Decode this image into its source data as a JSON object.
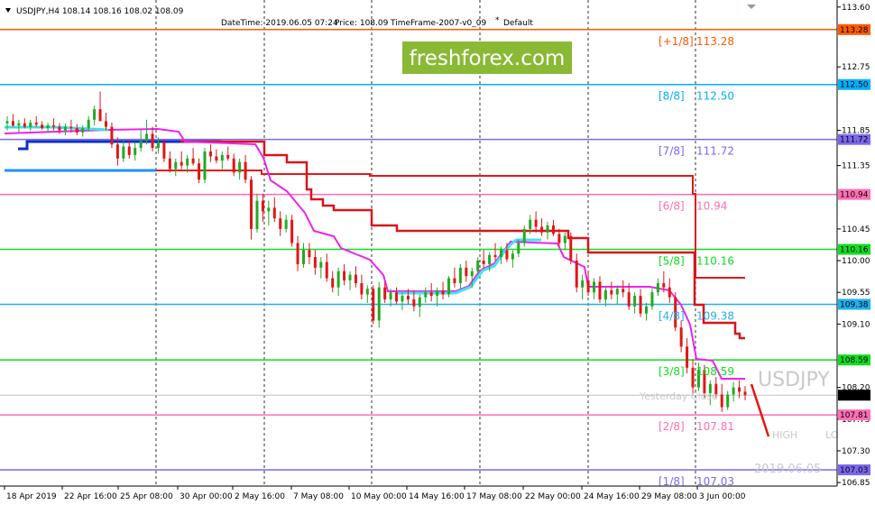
{
  "header": {
    "symbol_line": "USDJPY,H4  108.14 108.16 108.02 108.09",
    "date_label": "DateTime: 2019.06.05 07:24",
    "price_label": "Price: 108.09",
    "timeframe_label": "TimeFrame-2007-v0_09",
    "default_label": "Default"
  },
  "watermark": {
    "brand": "freshforex.com",
    "brand_color": "#8ab935",
    "symbol": "USDJPY",
    "yesterday": "Yesterday Close",
    "high_label": "HIGH",
    "low_label": "LO",
    "date_faint": "2019.06.05"
  },
  "chart_data": {
    "type": "candlestick",
    "symbol": "USDJPY",
    "timeframe": "H4",
    "ylim": [
      106.8,
      113.7
    ],
    "y_ticks": [
      "113.60",
      "112.75",
      "111.85",
      "111.35",
      "110.45",
      "110.00",
      "109.55",
      "109.10",
      "108.20",
      "107.75",
      "107.30",
      "106.85"
    ],
    "x_ticks": [
      "18 Apr 2019",
      "22 Apr 16:00",
      "25 Apr 08:00",
      "30 Apr 00:00",
      "2 May 16:00",
      "7 May 08:00",
      "10 May 00:00",
      "14 May 16:00",
      "17 May 08:00",
      "22 May 00:00",
      "24 May 16:00",
      "29 May 08:00",
      "3 Jun 00:00"
    ],
    "current_price": "108.09",
    "current_price_alt": "108.14",
    "murrey_levels": [
      {
        "label": "[+1/8]",
        "value": 113.28,
        "value_text": "113.28",
        "color": "#ff5a00"
      },
      {
        "label": "[8/8]",
        "value": 112.5,
        "value_text": "112.50",
        "color": "#00b0ff"
      },
      {
        "label": "[7/8]",
        "value": 111.72,
        "value_text": "111.72",
        "color": "#7b68ee"
      },
      {
        "label": "[6/8]",
        "value": 110.94,
        "value_text": "10.94",
        "color": "#ff6eb4"
      },
      {
        "label": "[5/8]",
        "value": 110.16,
        "value_text": "110.16",
        "color": "#11dd22"
      },
      {
        "label": "[4/8]",
        "value": 109.38,
        "value_text": "109.38",
        "color": "#1eb0f0"
      },
      {
        "label": "[3/8]",
        "value": 108.59,
        "value_text": "108.59",
        "color": "#11dd22"
      },
      {
        "label": "[2/8]",
        "value": 107.81,
        "value_text": "107.81",
        "color": "#ff6eb4"
      },
      {
        "label": "[1/8]",
        "value": 107.03,
        "value_text": "107.03",
        "color": "#7b68ee"
      }
    ],
    "axis_badges": [
      "113.28",
      "112.50",
      "111.72",
      "110.94",
      "110.16",
      "109.38",
      "108.59",
      "107.81",
      "107.03"
    ],
    "candles": [
      [
        111.95,
        112.05,
        111.85,
        111.98
      ],
      [
        111.98,
        112.08,
        111.9,
        111.92
      ],
      [
        111.92,
        112.0,
        111.82,
        111.95
      ],
      [
        111.95,
        112.02,
        111.88,
        111.9
      ],
      [
        111.9,
        112.0,
        111.84,
        111.96
      ],
      [
        111.96,
        112.05,
        111.9,
        111.93
      ],
      [
        111.93,
        111.98,
        111.86,
        111.88
      ],
      [
        111.88,
        111.96,
        111.82,
        111.92
      ],
      [
        111.92,
        112.02,
        111.85,
        111.9
      ],
      [
        111.9,
        111.95,
        111.8,
        111.85
      ],
      [
        111.85,
        111.95,
        111.78,
        111.9
      ],
      [
        111.9,
        112.0,
        111.82,
        111.88
      ],
      [
        111.88,
        111.94,
        111.78,
        111.82
      ],
      [
        111.82,
        111.92,
        111.76,
        111.88
      ],
      [
        111.88,
        112.05,
        111.84,
        112.0
      ],
      [
        112.0,
        112.2,
        111.92,
        112.15
      ],
      [
        112.15,
        112.4,
        112.05,
        111.98
      ],
      [
        111.98,
        112.1,
        111.85,
        111.9
      ],
      [
        111.9,
        111.96,
        111.6,
        111.65
      ],
      [
        111.65,
        111.75,
        111.35,
        111.45
      ],
      [
        111.45,
        111.7,
        111.4,
        111.62
      ],
      [
        111.62,
        111.72,
        111.45,
        111.5
      ],
      [
        111.5,
        111.68,
        111.42,
        111.6
      ],
      [
        111.6,
        111.85,
        111.55,
        111.7
      ],
      [
        111.7,
        112.0,
        111.65,
        111.8
      ],
      [
        111.8,
        111.9,
        111.55,
        111.6
      ],
      [
        111.6,
        111.75,
        111.52,
        111.68
      ],
      [
        111.68,
        111.72,
        111.4,
        111.45
      ],
      [
        111.45,
        111.55,
        111.25,
        111.3
      ],
      [
        111.3,
        111.45,
        111.2,
        111.4
      ],
      [
        111.4,
        111.55,
        111.3,
        111.35
      ],
      [
        111.35,
        111.5,
        111.25,
        111.45
      ],
      [
        111.45,
        111.6,
        111.35,
        111.38
      ],
      [
        111.38,
        111.45,
        111.1,
        111.15
      ],
      [
        111.15,
        111.6,
        111.1,
        111.55
      ],
      [
        111.55,
        111.65,
        111.4,
        111.48
      ],
      [
        111.48,
        111.58,
        111.38,
        111.42
      ],
      [
        111.42,
        111.55,
        111.3,
        111.5
      ],
      [
        111.5,
        111.62,
        111.42,
        111.45
      ],
      [
        111.45,
        111.52,
        111.2,
        111.25
      ],
      [
        111.25,
        111.45,
        111.15,
        111.4
      ],
      [
        111.4,
        111.5,
        111.1,
        111.15
      ],
      [
        111.15,
        111.2,
        110.3,
        110.45
      ],
      [
        110.45,
        110.95,
        110.4,
        110.85
      ],
      [
        110.85,
        110.95,
        110.55,
        110.7
      ],
      [
        110.7,
        110.85,
        110.5,
        110.75
      ],
      [
        110.75,
        110.9,
        110.55,
        110.6
      ],
      [
        110.6,
        110.7,
        110.35,
        110.45
      ],
      [
        110.45,
        110.65,
        110.4,
        110.58
      ],
      [
        110.58,
        110.65,
        110.2,
        110.25
      ],
      [
        110.25,
        110.35,
        109.85,
        109.95
      ],
      [
        109.95,
        110.25,
        109.9,
        110.15
      ],
      [
        110.15,
        110.25,
        109.95,
        110.05
      ],
      [
        110.05,
        110.15,
        109.8,
        109.9
      ],
      [
        109.9,
        110.05,
        109.75,
        109.98
      ],
      [
        109.98,
        110.1,
        109.7,
        109.75
      ],
      [
        109.75,
        109.85,
        109.55,
        109.62
      ],
      [
        109.62,
        109.9,
        109.5,
        109.85
      ],
      [
        109.85,
        109.95,
        109.65,
        109.72
      ],
      [
        109.72,
        109.85,
        109.58,
        109.8
      ],
      [
        109.8,
        109.92,
        109.62,
        109.68
      ],
      [
        109.68,
        109.8,
        109.45,
        109.52
      ],
      [
        109.52,
        109.65,
        109.4,
        109.6
      ],
      [
        109.6,
        109.65,
        109.1,
        109.15
      ],
      [
        109.15,
        109.7,
        109.05,
        109.62
      ],
      [
        109.62,
        109.7,
        109.4,
        109.45
      ],
      [
        109.45,
        109.6,
        109.35,
        109.55
      ],
      [
        109.55,
        109.62,
        109.38,
        109.42
      ],
      [
        109.42,
        109.55,
        109.3,
        109.5
      ],
      [
        109.5,
        109.6,
        109.38,
        109.45
      ],
      [
        109.45,
        109.58,
        109.28,
        109.35
      ],
      [
        109.35,
        109.52,
        109.2,
        109.48
      ],
      [
        109.48,
        109.62,
        109.4,
        109.55
      ],
      [
        109.55,
        109.68,
        109.42,
        109.5
      ],
      [
        109.5,
        109.62,
        109.35,
        109.58
      ],
      [
        109.58,
        109.7,
        109.45,
        109.52
      ],
      [
        109.52,
        109.78,
        109.48,
        109.75
      ],
      [
        109.75,
        109.9,
        109.62,
        109.68
      ],
      [
        109.68,
        109.95,
        109.6,
        109.9
      ],
      [
        109.9,
        110.0,
        109.7,
        109.78
      ],
      [
        109.78,
        109.9,
        109.62,
        109.85
      ],
      [
        109.85,
        110.05,
        109.8,
        110.0
      ],
      [
        110.0,
        110.15,
        109.88,
        109.95
      ],
      [
        109.95,
        110.12,
        109.85,
        110.08
      ],
      [
        110.08,
        110.25,
        110.0,
        110.05
      ],
      [
        110.05,
        110.2,
        109.95,
        110.15
      ],
      [
        110.15,
        110.25,
        109.98,
        110.02
      ],
      [
        110.02,
        110.15,
        109.9,
        110.1
      ],
      [
        110.1,
        110.3,
        110.05,
        110.25
      ],
      [
        110.25,
        110.5,
        110.2,
        110.45
      ],
      [
        110.45,
        110.65,
        110.38,
        110.58
      ],
      [
        110.58,
        110.7,
        110.4,
        110.48
      ],
      [
        110.48,
        110.6,
        110.35,
        110.4
      ],
      [
        110.4,
        110.55,
        110.3,
        110.5
      ],
      [
        110.5,
        110.58,
        110.35,
        110.38
      ],
      [
        110.38,
        110.45,
        110.2,
        110.25
      ],
      [
        110.25,
        110.4,
        110.15,
        110.35
      ],
      [
        110.35,
        110.4,
        109.95,
        110.0
      ],
      [
        110.0,
        110.1,
        109.55,
        109.62
      ],
      [
        109.62,
        109.8,
        109.45,
        109.72
      ],
      [
        109.72,
        109.85,
        109.5,
        109.55
      ],
      [
        109.55,
        109.75,
        109.45,
        109.7
      ],
      [
        109.7,
        109.78,
        109.4,
        109.45
      ],
      [
        109.45,
        109.62,
        109.35,
        109.58
      ],
      [
        109.58,
        109.7,
        109.45,
        109.52
      ],
      [
        109.52,
        109.65,
        109.38,
        109.6
      ],
      [
        109.6,
        109.72,
        109.48,
        109.55
      ],
      [
        109.55,
        109.68,
        109.3,
        109.35
      ],
      [
        109.35,
        109.55,
        109.25,
        109.5
      ],
      [
        109.5,
        109.6,
        109.2,
        109.25
      ],
      [
        109.25,
        109.4,
        109.15,
        109.35
      ],
      [
        109.35,
        109.6,
        109.3,
        109.55
      ],
      [
        109.55,
        109.75,
        109.5,
        109.68
      ],
      [
        109.68,
        109.85,
        109.55,
        109.62
      ],
      [
        109.62,
        109.75,
        109.4,
        109.48
      ],
      [
        109.48,
        109.55,
        109.0,
        109.05
      ],
      [
        109.05,
        109.15,
        108.7,
        108.78
      ],
      [
        108.78,
        108.9,
        108.4,
        108.48
      ],
      [
        108.48,
        108.6,
        108.1,
        108.2
      ],
      [
        108.2,
        108.55,
        108.15,
        108.45
      ],
      [
        108.45,
        108.52,
        108.05,
        108.12
      ],
      [
        108.12,
        108.3,
        107.95,
        108.25
      ],
      [
        108.25,
        108.35,
        108.05,
        108.1
      ],
      [
        108.1,
        108.25,
        107.85,
        107.92
      ],
      [
        107.92,
        108.15,
        107.88,
        108.1
      ],
      [
        108.1,
        108.28,
        108.0,
        108.2
      ],
      [
        108.2,
        108.3,
        108.05,
        108.14
      ],
      [
        108.14,
        108.22,
        108.02,
        108.09
      ]
    ]
  }
}
